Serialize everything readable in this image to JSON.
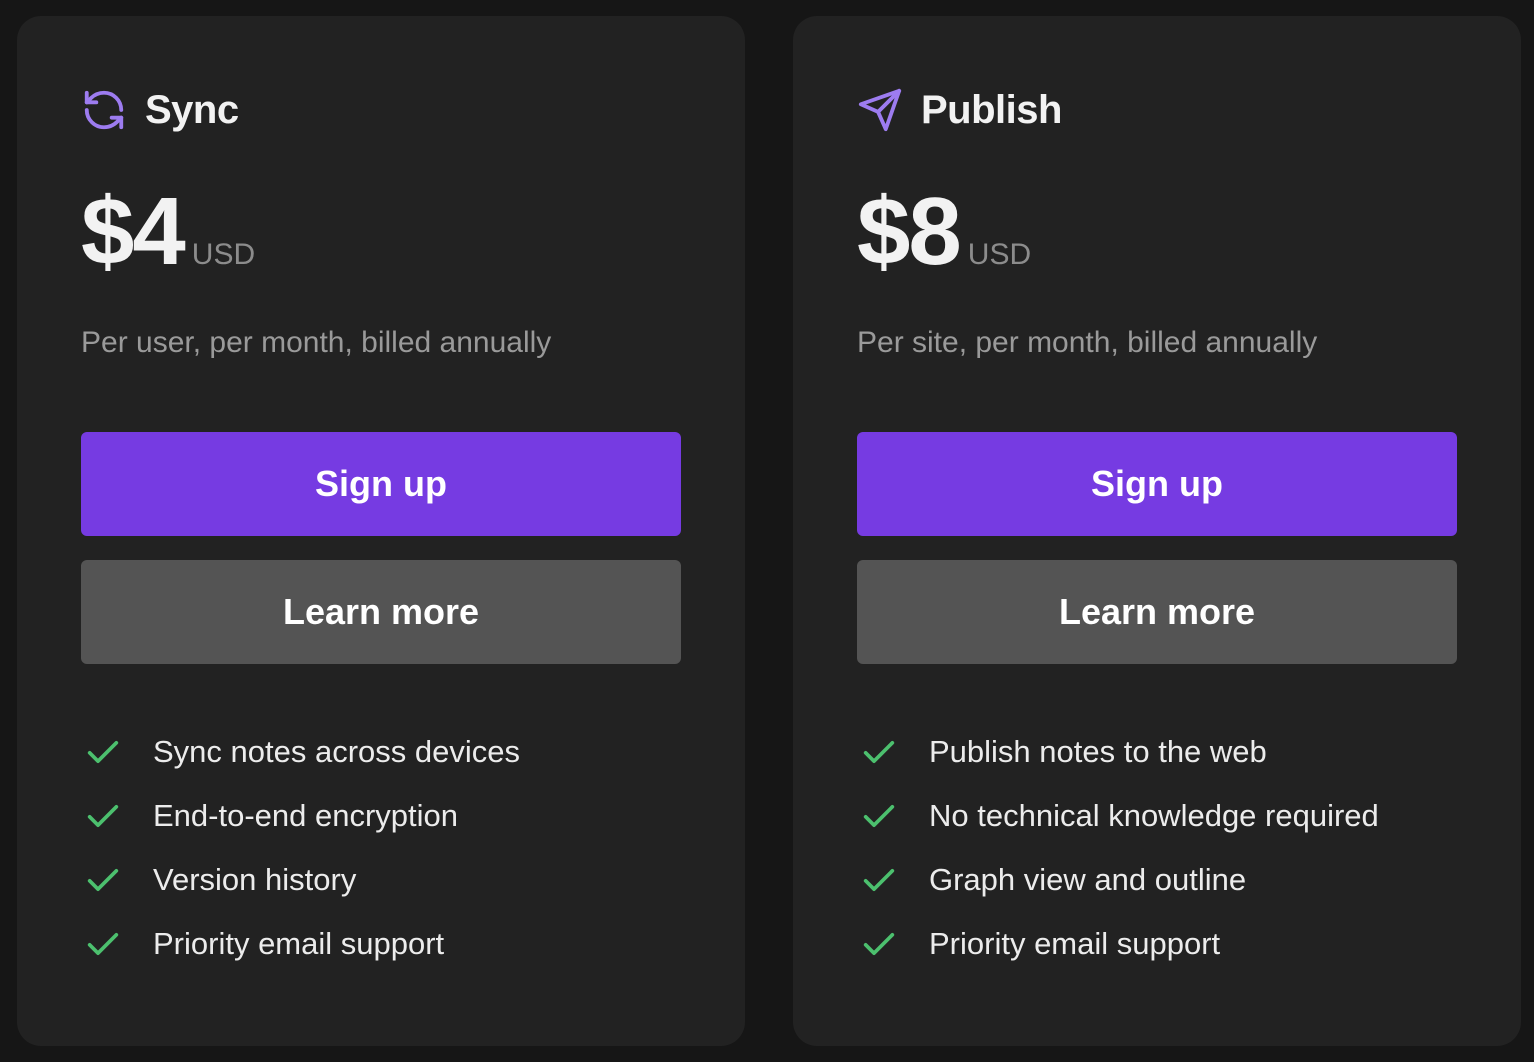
{
  "plans": [
    {
      "name": "Sync",
      "icon": "sync-icon",
      "price": "$4",
      "currency": "USD",
      "note": "Per user, per month, billed annually",
      "primary_label": "Sign up",
      "secondary_label": "Learn more",
      "features": [
        "Sync notes across devices",
        "End-to-end encryption",
        "Version history",
        "Priority email support"
      ]
    },
    {
      "name": "Publish",
      "icon": "send-icon",
      "price": "$8",
      "currency": "USD",
      "note": "Per site, per month, billed annually",
      "primary_label": "Sign up",
      "secondary_label": "Learn more",
      "features": [
        "Publish notes to the web",
        "No technical knowledge required",
        "Graph view and outline",
        "Priority email support"
      ]
    }
  ],
  "colors": {
    "background": "#161616",
    "card": "#222222",
    "accent": "#763be2",
    "icon_accent": "#9d7cf0",
    "secondary_button": "#545454",
    "check": "#4cc06e"
  }
}
